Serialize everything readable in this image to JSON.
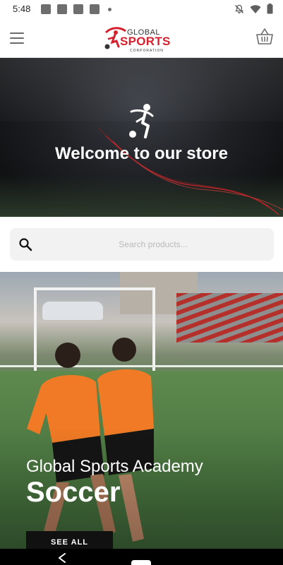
{
  "status_bar": {
    "time": "5:48",
    "notification_icons": [
      "app-notification-icon",
      "app-notification-icon",
      "app-notification-icon",
      "app-notification-icon"
    ],
    "right_icons": [
      "notifications-off-icon",
      "wifi-icon",
      "battery-icon"
    ]
  },
  "header": {
    "menu_icon": "hamburger-menu-icon",
    "logo": {
      "line1": "GLOBAL",
      "line2": "SPORTS",
      "line3": "CORPORATION"
    },
    "cart_icon": "shopping-basket-icon"
  },
  "hero": {
    "icon": "soccer-player-icon",
    "title": "Welcome to our store"
  },
  "search": {
    "icon": "search-icon",
    "placeholder": "Search products..."
  },
  "promo": {
    "subtitle": "Global Sports Academy",
    "title": "Soccer",
    "button_label": "SEE ALL"
  },
  "nav_bar": {
    "back_icon": "back-icon",
    "home_icon": "home-pill-icon"
  },
  "colors": {
    "brand_red": "#d6202e",
    "button_black": "#111111",
    "search_bg": "#f2f2f2"
  }
}
